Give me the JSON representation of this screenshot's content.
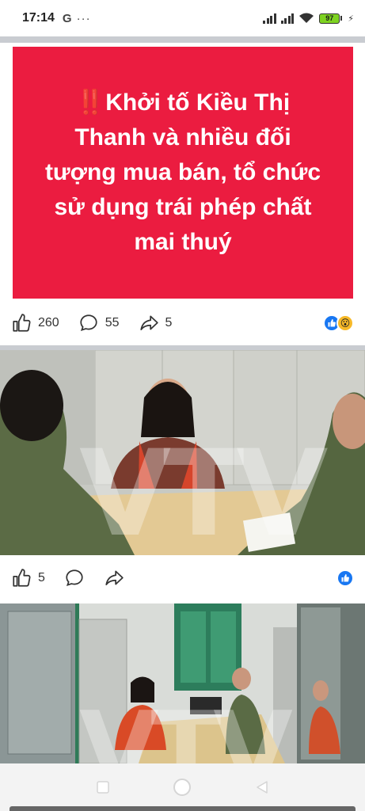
{
  "status_bar": {
    "time": "17:14",
    "g_icon": "G",
    "dots": "···",
    "battery": "97"
  },
  "post1": {
    "headline_mark": "‼️",
    "headline": "Khởi tố Kiều Thị Thanh và nhiều đối tượng mua bán, tổ chức sử dụng trái phép chất mai thuý",
    "likes": "260",
    "comments": "55",
    "shares": "5"
  },
  "post2": {
    "watermark": "VTV",
    "likes": "5"
  },
  "post3": {
    "watermark": "VTV"
  },
  "colors": {
    "banner": "#eb1c40",
    "fb_blue": "#1877f2",
    "wow": "#f7b928"
  }
}
